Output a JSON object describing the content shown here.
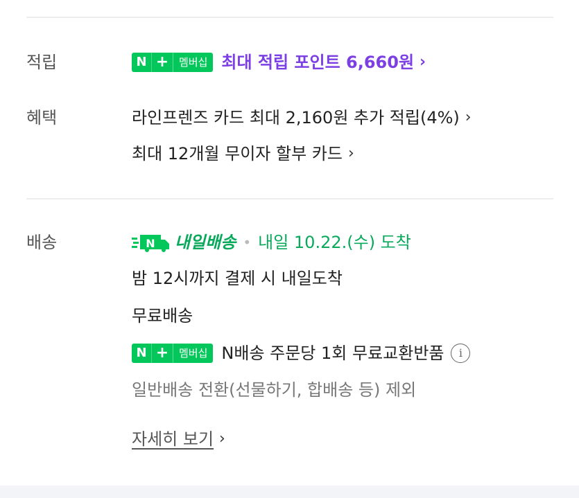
{
  "points": {
    "label": "적립",
    "badge": {
      "n": "N",
      "plus": "+",
      "text": "멤버십"
    },
    "text": "최대 적립 포인트 6,660원",
    "chevron": "›"
  },
  "benefits": {
    "label": "혜택",
    "lines": [
      {
        "text": "라인프렌즈 카드 최대 2,160원 추가 적립(4%)",
        "chevron": "›"
      },
      {
        "text": "최대 12개월 무이자 할부 카드",
        "chevron": "›"
      }
    ]
  },
  "delivery": {
    "label": "배송",
    "tomorrow_badge": "내일배송",
    "separator": "•",
    "arrival": "내일 10.22.(수) 도착",
    "cutoff": "밤 12시까지 결제 시 내일도착",
    "shipping_fee": "무료배송",
    "membership_badge": {
      "n": "N",
      "plus": "+",
      "text": "멤버십"
    },
    "membership_benefit": "N배송 주문당 1회 무료교환반품",
    "info_icon": "i",
    "exclusion": "일반배송 전환(선물하기, 합배송 등) 제외",
    "details_link": "자세히 보기",
    "details_chevron": "›"
  },
  "colors": {
    "accent_purple": "#7b3fe4",
    "accent_green": "#03c75a",
    "delivery_green": "#09a95c"
  }
}
